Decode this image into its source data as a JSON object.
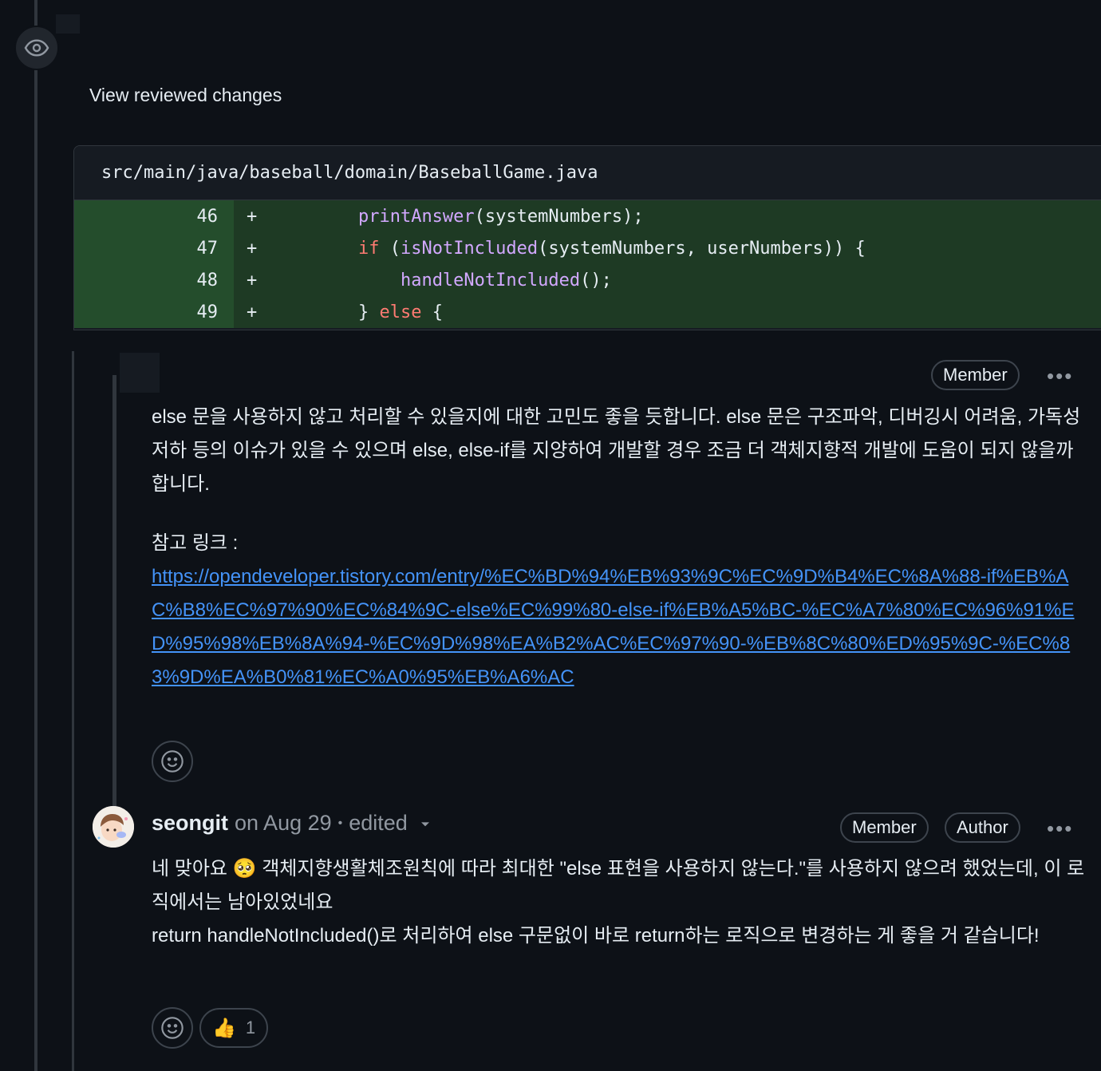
{
  "review": {
    "view_changes_label": "View reviewed changes"
  },
  "file": {
    "path": "src/main/java/baseball/domain/BaseballGame.java",
    "lines": [
      {
        "number": "46",
        "sign": "+"
      },
      {
        "number": "47",
        "sign": "+"
      },
      {
        "number": "48",
        "sign": "+"
      },
      {
        "number": "49",
        "sign": "+"
      }
    ],
    "code": {
      "l46_fn": "printAnswer",
      "l46_rest": "(systemNumbers);",
      "l47_kw": "if",
      "l47_fn": "isNotIncluded",
      "l47_rest": "(systemNumbers, userNumbers)) {",
      "l48_fn": "handleNotIncluded",
      "l48_rest": "();",
      "l49_brace": "}",
      "l49_kw": "else",
      "l49_rest": "{"
    }
  },
  "comment1": {
    "badge": "Member",
    "more": "•••",
    "body": "else 문을 사용하지 않고 처리할 수 있을지에 대한 고민도 좋을 듯합니다. else 문은 구조파악, 디버깅시 어려움, 가독성 저하 등의 이슈가 있을 수 있으며 else, else-if를 지양하여 개발할 경우 조금 더 객체지향적 개발에 도움이 되지 않을까 합니다.",
    "ref_label": "참고 링크 :",
    "ref_link": "https://opendeveloper.tistory.com/entry/%EC%BD%94%EB%93%9C%EC%9D%B4%EC%8A%88-if%EB%AC%B8%EC%97%90%EC%84%9C-else%EC%99%80-else-if%EB%A5%BC-%EC%A7%80%EC%96%91%ED%95%98%EB%8A%94-%EC%9D%98%EA%B2%AC%EC%97%90-%EB%8C%80%ED%95%9C-%EC%83%9D%EA%B0%81%EC%A0%95%EB%A6%AC"
  },
  "comment2": {
    "author": "seongit",
    "date": "on Aug 29",
    "separator": "•",
    "edited": "edited",
    "badges": [
      "Member",
      "Author"
    ],
    "more": "•••",
    "line1": "네 맞아요 🥺 객체지향생활체조원칙에 따라 최대한 \"else 표현을 사용하지 않는다.\"를 사용하지 않으려 했었는데, 이 로직에서는 남아있었네요",
    "line2": "return handleNotIncluded()로 처리하여 else 구문없이 바로 return하는 로직으로 변경하는 게 좋을 거 같습니다!",
    "thumb_emoji": "👍",
    "thumb_count": "1"
  },
  "colors": {
    "background": "#0d1117",
    "added_line": "#1e3a24",
    "link": "#4493f8",
    "keyword": "#ff7b72",
    "function": "#d2a8ff"
  },
  "icons": [
    "eye-icon",
    "smiley-icon",
    "chevron-down-icon",
    "kebab-icon",
    "thumbs-up-icon"
  ]
}
